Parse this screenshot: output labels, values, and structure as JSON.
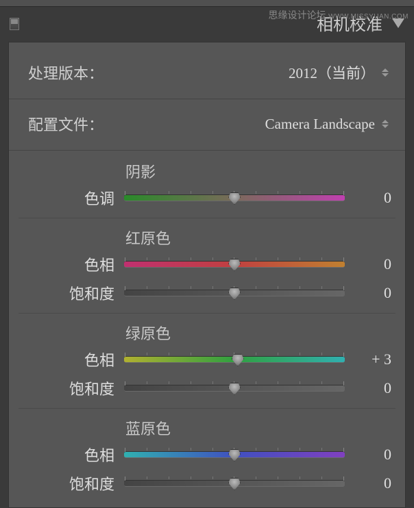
{
  "watermark": {
    "cn": "思缘设计论坛",
    "en": "WWW.MISSYUAN.COM"
  },
  "panel": {
    "title": "相机校准"
  },
  "process": {
    "label": "处理版本：",
    "value": "2012（当前）"
  },
  "profile": {
    "label": "配置文件：",
    "value": "Camera Landscape"
  },
  "groups": {
    "shadow": {
      "title": "阴影",
      "tint": {
        "label": "色调",
        "value": "0",
        "pos": 50
      }
    },
    "red": {
      "title": "红原色",
      "hue": {
        "label": "色相",
        "value": "0",
        "pos": 50
      },
      "sat": {
        "label": "饱和度",
        "value": "0",
        "pos": 50
      }
    },
    "green": {
      "title": "绿原色",
      "hue": {
        "label": "色相",
        "value": "+ 3",
        "pos": 51.5
      },
      "sat": {
        "label": "饱和度",
        "value": "0",
        "pos": 50
      }
    },
    "blue": {
      "title": "蓝原色",
      "hue": {
        "label": "色相",
        "value": "0",
        "pos": 50
      },
      "sat": {
        "label": "饱和度",
        "value": "0",
        "pos": 50
      }
    }
  }
}
